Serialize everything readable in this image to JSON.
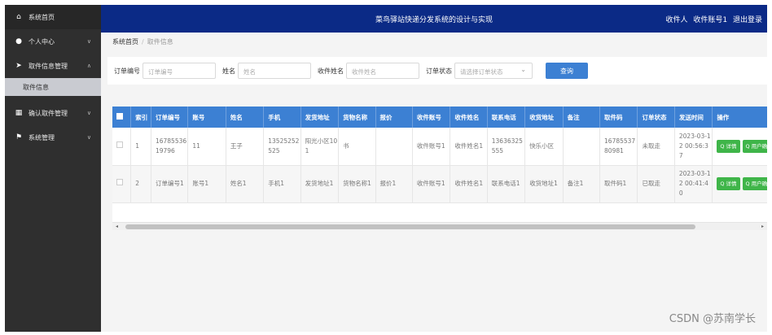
{
  "header": {
    "title": "菜鸟驿站快递分发系统的设计与实现",
    "user_role": "收件人",
    "user_account": "收件账号1",
    "logout": "退出登录"
  },
  "sidebar": {
    "items": [
      {
        "icon": "home-icon",
        "label": "系统首页"
      },
      {
        "icon": "user-icon",
        "label": "个人中心"
      },
      {
        "icon": "send-icon",
        "label": "取件信息管理",
        "sub": "取件信息"
      },
      {
        "icon": "grid-icon",
        "label": "确认取件管理"
      },
      {
        "icon": "flag-icon",
        "label": "系统管理"
      }
    ]
  },
  "breadcrumb": {
    "home": "系统首页",
    "current": "取件信息"
  },
  "search": {
    "order_label": "订单编号",
    "order_placeholder": "订单编号",
    "name_label": "姓名",
    "name_placeholder": "姓名",
    "recv_label": "收件姓名",
    "recv_placeholder": "收件姓名",
    "status_label": "订单状态",
    "status_placeholder": "请选择订单状态",
    "query_button": "查询"
  },
  "table": {
    "headers": [
      "索引",
      "订单编号",
      "账号",
      "姓名",
      "手机",
      "发货地址",
      "货物名称",
      "报价",
      "收件账号",
      "收件姓名",
      "联系电话",
      "收货地址",
      "备注",
      "取件码",
      "订单状态",
      "发送时间",
      "操作"
    ],
    "rows": [
      [
        "1",
        "1678553619796",
        "11",
        "王子",
        "13525252525",
        "阳光小区101",
        "书",
        "",
        "收件账号1",
        "收件姓名1",
        "13636325555",
        "快乐小区",
        "",
        "1678553780981",
        "未取走",
        "2023-03-12 00:56:37"
      ],
      [
        "2",
        "订单编号1",
        "账号1",
        "姓名1",
        "手机1",
        "发货地址1",
        "货物名称1",
        "报价1",
        "收件账号1",
        "收件姓名1",
        "联系电话1",
        "收货地址1",
        "备注1",
        "取件码1",
        "已取走",
        "2023-03-12 00:41:40"
      ]
    ],
    "op_detail": "Q 详情",
    "op_sign": "Q 用户确"
  },
  "watermark": "CSDN @苏南学长"
}
